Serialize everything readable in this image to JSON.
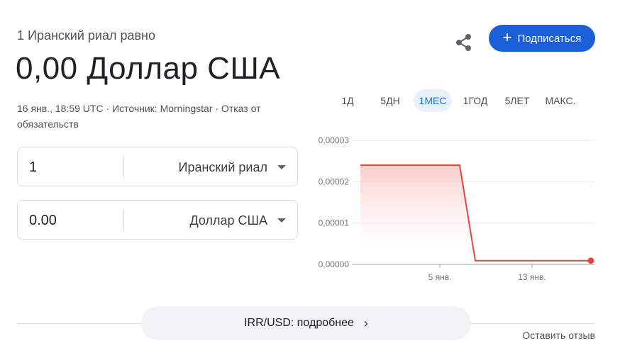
{
  "header": {
    "subtitle": "1 Иранский риал равно",
    "amount": "0,00 Доллар США",
    "meta_line1": "16 янв., 18:59 UTC · Источник: Morningstar · Отказ от",
    "meta_line2": "обязательств"
  },
  "actions": {
    "share_icon": "share-icon",
    "subscribe_label": "Подписаться"
  },
  "converter": {
    "from": {
      "value": "1",
      "currency": "Иранский риал"
    },
    "to": {
      "value": "0.00",
      "currency": "Доллар США"
    }
  },
  "tabs": [
    "1Д",
    "5ДН",
    "1МЕС",
    "1ГОД",
    "5ЛЕТ",
    "МАКС."
  ],
  "active_tab": "1МЕС",
  "chart_data": {
    "type": "area",
    "y_ticks": [
      "0,00003",
      "0,00002",
      "0,00001",
      "0,00000"
    ],
    "x_ticks": [
      "5 янв.",
      "13 янв."
    ],
    "ylim": [
      0,
      3e-05
    ],
    "x": [
      "28 дек.",
      "5 янв.",
      "6 янв.",
      "13 янв.",
      "16 янв."
    ],
    "values": [
      2.4e-05,
      2.4e-05,
      9e-07,
      9e-07,
      9e-07
    ],
    "grid": true,
    "colors": {
      "line": "#e8453c",
      "fill": "#f7c6c3"
    }
  },
  "footer": {
    "more_label": "IRR/USD: подробнее",
    "feedback": "Оставить отзыв"
  },
  "colors": {
    "accent": "#1b5fd9",
    "tab_active": "#1a73e8"
  }
}
